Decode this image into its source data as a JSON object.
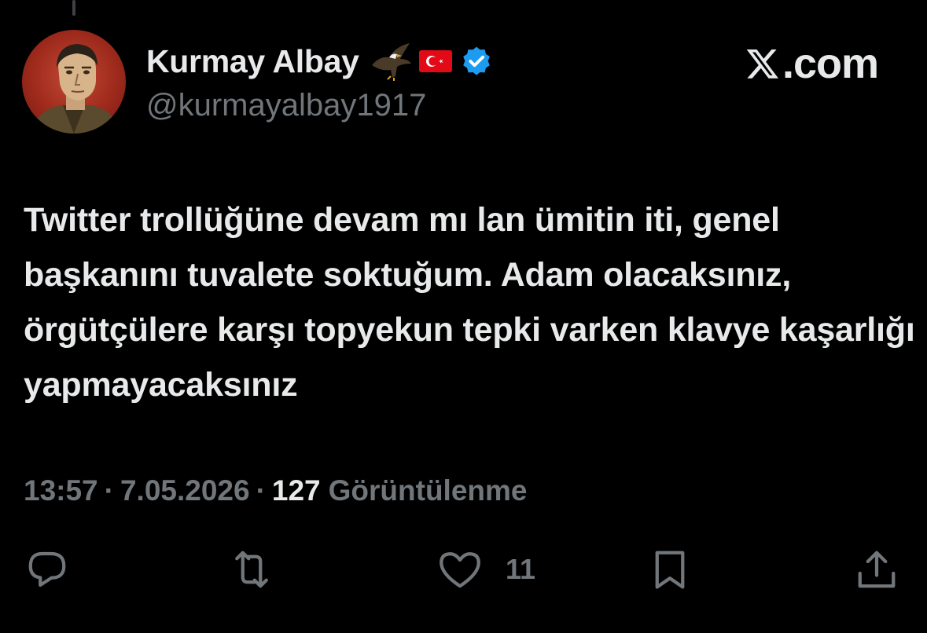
{
  "author": {
    "display_name": "Kurmay Albay",
    "handle": "@kurmayalbay1917",
    "badges": [
      "eagle-emoji",
      "turkey-flag-emoji",
      "verified-badge-icon"
    ]
  },
  "brand": {
    "label": ".com",
    "logo": "x-logo-icon"
  },
  "tweet": {
    "text": "Twitter trollüğüne devam mı lan ümitin iti, genel başkanını tuvalete soktuğum. Adam olacaksınız, örgütçülere karşı topyekun tepki varken klavye kaşarlığı yapmayacaksınız"
  },
  "meta": {
    "time": "13:57",
    "date": "7.05.2026",
    "separator": "·",
    "views_count": "127",
    "views_label": "Görüntülenme"
  },
  "actions": {
    "reply_icon": "reply-icon",
    "retweet_icon": "retweet-icon",
    "like_icon": "heart-icon",
    "like_count": "11",
    "bookmark_icon": "bookmark-icon",
    "share_icon": "share-icon"
  },
  "colors": {
    "background": "#000000",
    "text": "#e7e9ea",
    "muted": "#71767b",
    "verified": "#1d9bf0",
    "flag": "#e30a17"
  }
}
